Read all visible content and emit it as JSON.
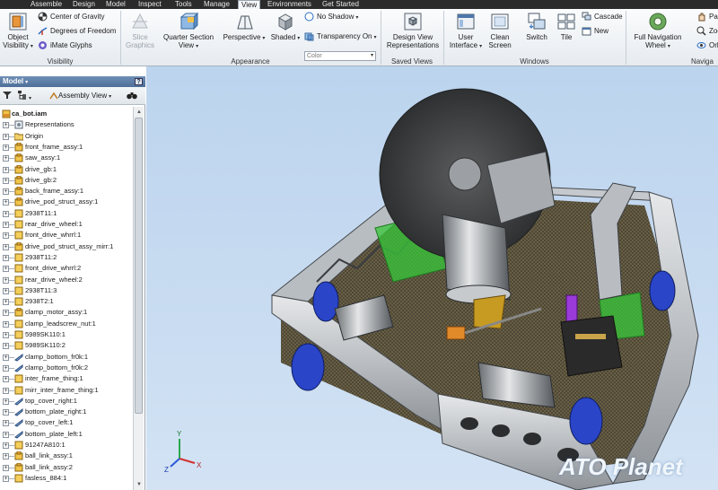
{
  "menu_tabs": [
    {
      "label": "Assemble"
    },
    {
      "label": "Design"
    },
    {
      "label": "Model"
    },
    {
      "label": "Inspect"
    },
    {
      "label": "Tools"
    },
    {
      "label": "Manage"
    },
    {
      "label": "View",
      "active": true
    },
    {
      "label": "Environments"
    },
    {
      "label": "Get Started"
    }
  ],
  "ribbon": {
    "visibility": {
      "group_label": "Visibility",
      "object_visibility": "Object Visibility",
      "center_of_gravity": "Center of Gravity",
      "degrees_of_freedom": "Degrees of Freedom",
      "imate_glyphs": "iMate Glyphs"
    },
    "appearance": {
      "group_label": "Appearance",
      "slice_graphics": "Slice Graphics",
      "quarter_section_view": "Quarter Section View",
      "perspective": "Perspective",
      "shaded": "Shaded",
      "no_shadow": "No Shadow",
      "transparency_on": "Transparency On",
      "color": "Color"
    },
    "saved_views": {
      "group_label": "Saved Views",
      "design_view_representations": "Design View Representations"
    },
    "windows": {
      "group_label": "Windows",
      "user_interface": "User Interface",
      "clean_screen": "Clean Screen",
      "switch": "Switch",
      "tile": "Tile",
      "cascade": "Cascade",
      "new": "New"
    },
    "navigate": {
      "group_label": "Naviga",
      "full_navigation_wheel": "Full Navigation Wheel",
      "pan": "Pa",
      "zoom": "Zoo",
      "orbit": "Orb"
    }
  },
  "browser": {
    "title": "Model",
    "help_glyph": "?",
    "assembly_view": "Assembly View",
    "tree": [
      {
        "label": "ca_bot.iam",
        "type": "root"
      },
      {
        "label": "Representations",
        "type": "reps"
      },
      {
        "label": "Origin",
        "type": "folder"
      },
      {
        "label": "front_frame_assy:1",
        "type": "asm"
      },
      {
        "label": "saw_assy:1",
        "type": "asm"
      },
      {
        "label": "drive_gb:1",
        "type": "asm"
      },
      {
        "label": "drive_gb:2",
        "type": "asm"
      },
      {
        "label": "back_frame_assy:1",
        "type": "asm"
      },
      {
        "label": "drive_pod_struct_assy:1",
        "type": "asm"
      },
      {
        "label": "2938T11:1",
        "type": "part"
      },
      {
        "label": "rear_drive_wheel:1",
        "type": "part"
      },
      {
        "label": "front_drive_whrrl:1",
        "type": "part"
      },
      {
        "label": "drive_pod_struct_assy_mirr:1",
        "type": "asm"
      },
      {
        "label": "2938T11:2",
        "type": "part"
      },
      {
        "label": "front_drive_whrrl:2",
        "type": "part"
      },
      {
        "label": "rear_drive_wheel:2",
        "type": "part"
      },
      {
        "label": "2938T11:3",
        "type": "part"
      },
      {
        "label": "2938T2:1",
        "type": "part"
      },
      {
        "label": "clamp_motor_assy:1",
        "type": "asm"
      },
      {
        "label": "clamp_leadscrew_nut:1",
        "type": "part"
      },
      {
        "label": "5989SK110:1",
        "type": "part"
      },
      {
        "label": "5989SK110:2",
        "type": "part"
      },
      {
        "label": "clamp_bottom_fr0k:1",
        "type": "sheet"
      },
      {
        "label": "clamp_bottom_fr0k:2",
        "type": "sheet"
      },
      {
        "label": "inter_frame_thing:1",
        "type": "part"
      },
      {
        "label": "mirr_inter_frame_thing:1",
        "type": "part"
      },
      {
        "label": "top_cover_right:1",
        "type": "sheet"
      },
      {
        "label": "bottom_plate_right:1",
        "type": "sheet"
      },
      {
        "label": "top_cover_left:1",
        "type": "sheet"
      },
      {
        "label": "bottom_plate_left:1",
        "type": "sheet"
      },
      {
        "label": "91247A810:1",
        "type": "part"
      },
      {
        "label": "ball_link_assy:1",
        "type": "asm"
      },
      {
        "label": "ball_link_assy:2",
        "type": "asm"
      },
      {
        "label": "fasless_884:1",
        "type": "part"
      }
    ]
  },
  "viewport": {
    "triad": {
      "x": "X",
      "y": "Y",
      "z": "Z"
    },
    "watermark": "ATO Planet"
  },
  "colors": {
    "menubar_bg": "#2b2b2b",
    "browser_header": "#4d6f98",
    "viewport_bg": "#c9dcf1",
    "saw_blade": "#3a3a3a",
    "wheels": "#2a45c8",
    "green_highlight": "#37c83a",
    "purple_part": "#9a3ad8",
    "brass_part": "#c79a22"
  }
}
